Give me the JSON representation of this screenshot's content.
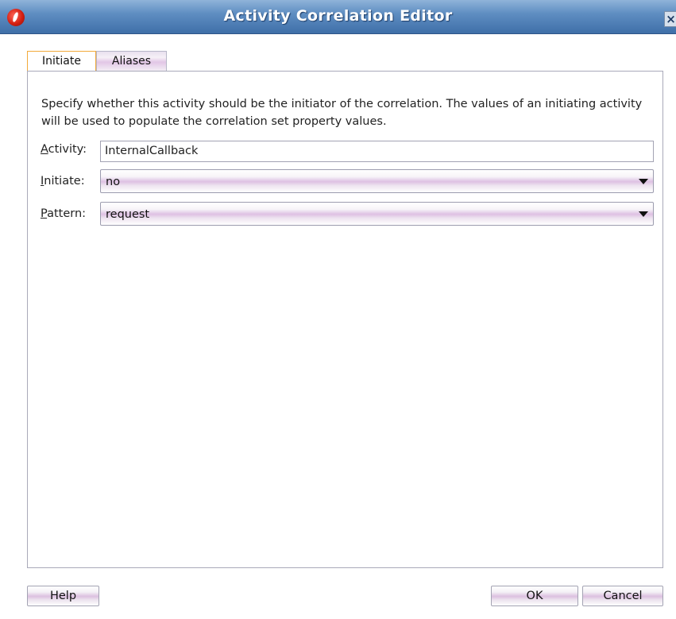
{
  "window": {
    "title": "Activity Correlation Editor",
    "close_label": "×"
  },
  "tabs": [
    {
      "label": "Initiate",
      "selected": true
    },
    {
      "label": "Aliases",
      "selected": false
    }
  ],
  "panel": {
    "description": "Specify whether this activity should be the initiator of the correlation. The values of an initiating activity will be used to populate the correlation set property values.",
    "activity": {
      "label_mnemonic": "A",
      "label_rest": "ctivity:",
      "value": "InternalCallback"
    },
    "initiate": {
      "label_mnemonic": "I",
      "label_rest": "nitiate:",
      "value": "no"
    },
    "pattern": {
      "label_mnemonic": "P",
      "label_rest": "attern:",
      "value": "request"
    }
  },
  "buttons": {
    "help": "Help",
    "ok": "OK",
    "cancel": "Cancel"
  },
  "colors": {
    "titlebar": "#5f8ec2",
    "selected_tab_border": "#f2a93a",
    "button_stripe": "#dcc0e0"
  },
  "icons": {
    "app": "oracle-app-icon",
    "close": "close-icon",
    "dropdown": "chevron-down-icon"
  }
}
